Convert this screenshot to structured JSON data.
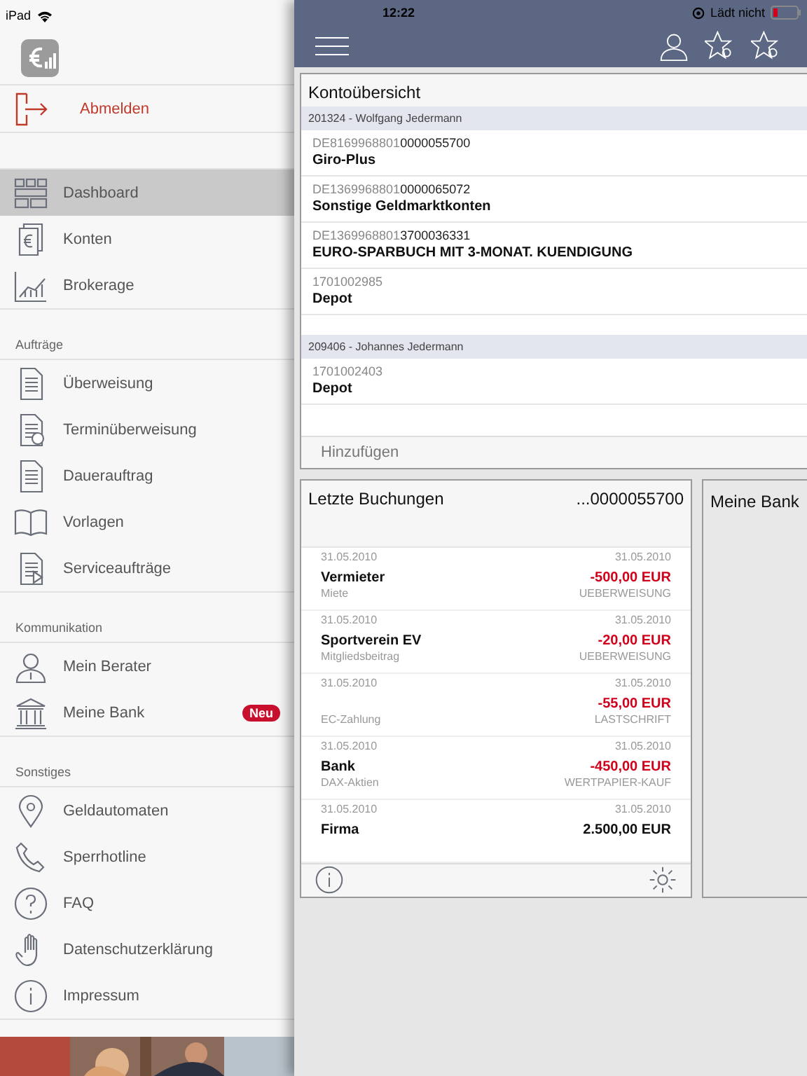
{
  "status_bar": {
    "device": "iPad",
    "time": "12:22",
    "charging": "Lädt nicht"
  },
  "sidebar": {
    "logout": "Abmelden",
    "sections": [
      {
        "items": [
          {
            "label": "Dashboard",
            "selected": true
          },
          {
            "label": "Konten",
            "selected": false
          },
          {
            "label": "Brokerage",
            "selected": false
          }
        ]
      },
      {
        "header": "Aufträge",
        "items": [
          {
            "label": "Überweisung",
            "selected": false
          },
          {
            "label": "Terminüberweisung",
            "selected": false
          },
          {
            "label": "Dauerauftrag",
            "selected": false
          },
          {
            "label": "Vorlagen",
            "selected": false
          },
          {
            "label": "Serviceaufträge",
            "selected": false
          }
        ]
      },
      {
        "header": "Kommunikation",
        "items": [
          {
            "label": "Mein Berater",
            "selected": false
          },
          {
            "label": "Meine Bank",
            "selected": false,
            "badge": "Neu"
          }
        ]
      },
      {
        "header": "Sonstiges",
        "items": [
          {
            "label": "Geldautomaten",
            "selected": false
          },
          {
            "label": "Sperrhotline",
            "selected": false
          },
          {
            "label": "FAQ",
            "selected": false
          },
          {
            "label": "Datenschutzerklärung",
            "selected": false
          },
          {
            "label": "Impressum",
            "selected": false
          }
        ]
      }
    ]
  },
  "overview": {
    "title": "Kontoübersicht",
    "add": "Hinzufügen",
    "groups": [
      {
        "header": "201324 - Wolfgang Jedermann",
        "accounts": [
          {
            "number": "DE8169968801**0000055700**",
            "name": "Giro-Plus"
          },
          {
            "number": "DE1369968801**0000065072**",
            "name": "Sonstige Geldmarktkonten"
          },
          {
            "number": "DE1369968801**3700036331**",
            "name": "EURO-SPARBUCH MIT 3-MONAT. KUENDIGUNG"
          },
          {
            "number": "1701002985",
            "name": "Depot"
          }
        ]
      },
      {
        "header": "209406 - Johannes Jedermann",
        "accounts": [
          {
            "number": "1701002403",
            "name": "Depot"
          }
        ]
      }
    ]
  },
  "bookings": {
    "title": "Letzte Buchungen",
    "account": "...0000055700",
    "rows": [
      {
        "date": "31.05.2010",
        "value_date": "31.05.2010",
        "name": "Vermieter",
        "amount": "-500,00 EUR",
        "debit": true,
        "purpose": "Miete",
        "type": "UEBERWEISUNG"
      },
      {
        "date": "31.05.2010",
        "value_date": "31.05.2010",
        "name": "Sportverein EV",
        "amount": "-20,00 EUR",
        "debit": true,
        "purpose": "Mitgliedsbeitrag",
        "type": "UEBERWEISUNG"
      },
      {
        "date": "31.05.2010",
        "value_date": "31.05.2010",
        "amount": "-55,00 EUR",
        "debit": true,
        "purpose": "EC-Zahlung",
        "type": "LASTSCHRIFT"
      },
      {
        "date": "31.05.2010",
        "value_date": "31.05.2010",
        "name": "Bank",
        "amount": "-450,00 EUR",
        "debit": true,
        "purpose": "DAX-Aktien",
        "type": "WERTPAPIER-KAUF"
      },
      {
        "date": "31.05.2010",
        "value_date": "31.05.2010",
        "name": "Firma",
        "amount": "2.500,00 EUR",
        "debit": false
      }
    ]
  },
  "bank_card": {
    "title": "Meine Bank"
  }
}
